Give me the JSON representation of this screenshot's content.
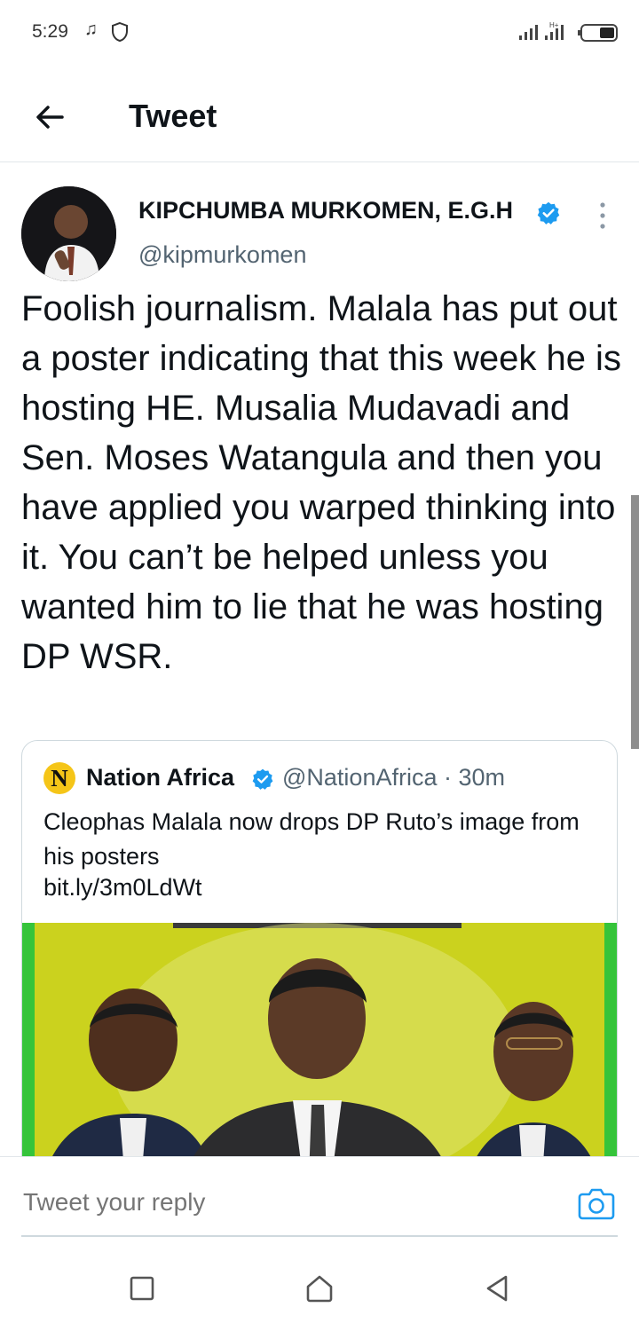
{
  "status_bar": {
    "time": "5:29",
    "icons": [
      "music-note-icon",
      "shield-icon",
      "signal-icon",
      "signal-icon",
      "battery-icon"
    ]
  },
  "header": {
    "title": "Tweet",
    "back_icon": "arrow-left-icon"
  },
  "tweet": {
    "author_name": "KIPCHUMBA MURKOMEN, E.G.H",
    "handle": "@kipmurkomen",
    "verified": true,
    "text": "Foolish journalism. Malala has put out a poster indicating that this week he is hosting HE. Musalia Mudavadi and Sen. Moses Watangula and then you have applied you warped thinking into it. You can’t be helped unless you wanted him to lie that he was hosting DP WSR."
  },
  "quoted_tweet": {
    "logo_letter": "N",
    "author_name": "Nation Africa",
    "meta": "@NationAfrica · 30m",
    "text": "Cleophas Malala now drops DP Ruto’s image from his posters",
    "link": "bit.ly/3m0LdWt",
    "image_background": "#cbd21e"
  },
  "reply_bar": {
    "placeholder": "Tweet your reply",
    "camera_icon": "camera-icon"
  },
  "nav_bar": {
    "buttons": [
      "recents-square-icon",
      "home-icon",
      "back-triangle-icon"
    ]
  },
  "colors": {
    "accent": "#1d9bf0",
    "text": "#0f1419",
    "secondary": "#536471"
  }
}
